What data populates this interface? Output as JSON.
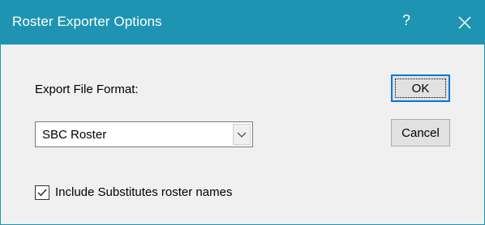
{
  "window": {
    "title": "Roster Exporter Options",
    "help_glyph": "?",
    "close_icon": "close-icon",
    "titlebar_color": "#1e94b2"
  },
  "form": {
    "export_format_label": "Export File Format:",
    "export_format_value": "SBC Roster",
    "include_substitutes_label": "Include Substitutes roster names",
    "include_substitutes_checked": true
  },
  "buttons": {
    "ok_label": "OK",
    "cancel_label": "Cancel"
  }
}
